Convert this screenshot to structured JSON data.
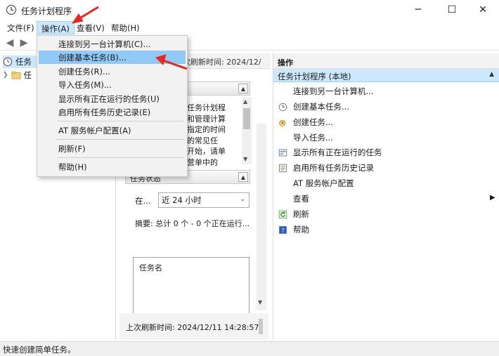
{
  "window": {
    "title": "任务计划程序",
    "icon": "clock-icon",
    "controls": {
      "minimize": "─",
      "maximize": "☐",
      "close": "✕"
    }
  },
  "menubar": {
    "items": [
      {
        "label": "文件(F)"
      },
      {
        "label": "操作(A)"
      },
      {
        "label": "查看(V)"
      },
      {
        "label": "帮助(H)"
      }
    ]
  },
  "dropdown": {
    "items": [
      {
        "label": "连接到另一台计算机(C)..."
      },
      {
        "label": "创建基本任务(B)..."
      },
      {
        "label": "创建任务(R)..."
      },
      {
        "label": "导入任务(M)..."
      },
      {
        "label": "显示所有正在运行的任务(U)"
      },
      {
        "label": "启用所有任务历史记录(E)"
      },
      {
        "label": "AT 服务帐户配置(A)"
      },
      {
        "label": "刷新(F)"
      },
      {
        "label": "帮助(H)"
      }
    ]
  },
  "tree": {
    "items": [
      {
        "label": "任务"
      },
      {
        "label": "任"
      }
    ]
  },
  "middle": {
    "last_refresh_top": "次刷新时间: 2024/12/",
    "description_lines": [
      "任务计划程",
      "和管理计算",
      "指定的时间",
      "的常见任",
      "开始，请单",
      "  营单中的"
    ],
    "status_section_title": "任务状态",
    "time_label": "在...",
    "time_select": "近 24 小时",
    "summary": "摘要: 总计 0 个 - 0 个正在运行...",
    "task_column": "任务名",
    "last_refresh_bottom": "上次刷新时间: 2024/12/11 14:28:57"
  },
  "actions": {
    "header": "操作",
    "group": "任务计划程序 (本地)",
    "items": [
      {
        "label": "连接到另一台计算机...",
        "icon": ""
      },
      {
        "label": "创建基本任务...",
        "icon": "create-basic-task-icon"
      },
      {
        "label": "创建任务...",
        "icon": "create-task-icon"
      },
      {
        "label": "导入任务...",
        "icon": ""
      },
      {
        "label": "显示所有正在运行的任务",
        "icon": "running-tasks-icon"
      },
      {
        "label": "启用所有任务历史记录",
        "icon": "history-icon"
      },
      {
        "label": "AT 服务帐户配置",
        "icon": ""
      },
      {
        "label": "查看",
        "icon": ""
      },
      {
        "label": "刷新",
        "icon": "refresh-icon"
      },
      {
        "label": "帮助",
        "icon": "help-icon"
      }
    ]
  },
  "statusbar": {
    "text": "快速创建简单任务。"
  },
  "colors": {
    "highlight": "#91c9f7",
    "selection": "#cce8ff",
    "annotation_arrow": "#e8281e"
  }
}
